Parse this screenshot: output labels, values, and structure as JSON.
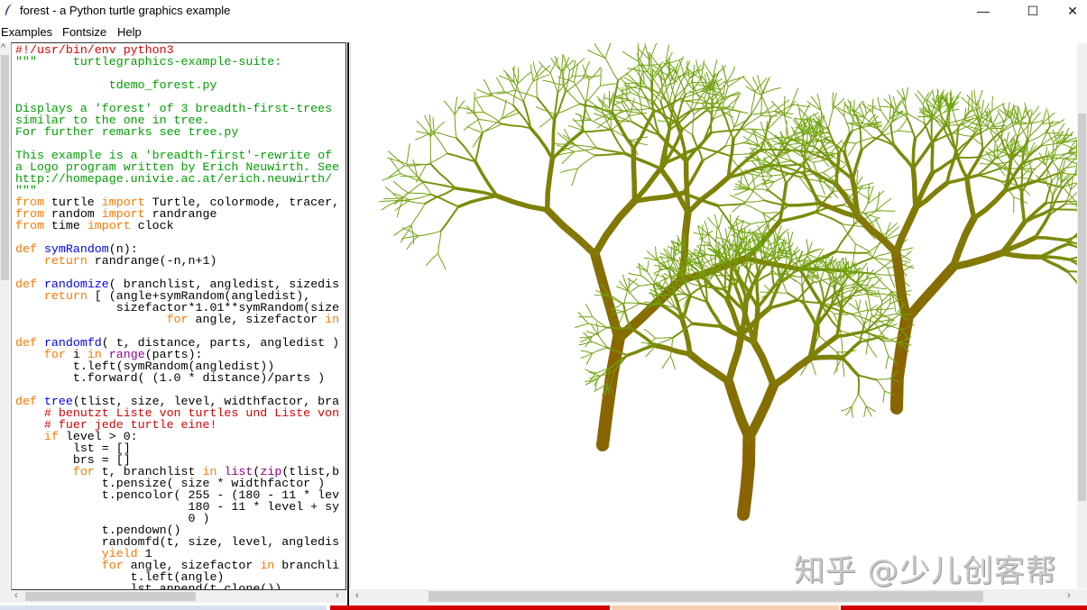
{
  "window": {
    "title": "forest - a Python turtle graphics example",
    "minimize": "—",
    "maximize": "☐",
    "close": "✕"
  },
  "menu": [
    "Examples",
    "Fontsize",
    "Help"
  ],
  "code": [
    [
      [
        "com",
        "#!/usr/bin/env python3"
      ]
    ],
    [
      [
        "str",
        "\"\"\"     turtlegraphics-example-suite:"
      ]
    ],
    [],
    [
      [
        "str",
        "             tdemo_forest.py"
      ]
    ],
    [],
    [
      [
        "str",
        "Displays a 'forest' of 3 breadth-first-trees"
      ]
    ],
    [
      [
        "str",
        "similar to the one in tree."
      ]
    ],
    [
      [
        "str",
        "For further remarks see tree.py"
      ]
    ],
    [],
    [
      [
        "str",
        "This example is a 'breadth-first'-rewrite of"
      ]
    ],
    [
      [
        "str",
        "a Logo program written by Erich Neuwirth. See"
      ]
    ],
    [
      [
        "str",
        "http://homepage.univie.ac.at/erich.neuwirth/"
      ]
    ],
    [
      [
        "str",
        "\"\"\""
      ]
    ],
    [
      [
        "kw",
        "from"
      ],
      [
        "",
        " turtle "
      ],
      [
        "kw",
        "import"
      ],
      [
        "",
        " Turtle, colormode, tracer,"
      ]
    ],
    [
      [
        "kw",
        "from"
      ],
      [
        "",
        " random "
      ],
      [
        "kw",
        "import"
      ],
      [
        "",
        " randrange"
      ]
    ],
    [
      [
        "kw",
        "from"
      ],
      [
        "",
        " time "
      ],
      [
        "kw",
        "import"
      ],
      [
        "",
        " clock"
      ]
    ],
    [],
    [
      [
        "kw",
        "def"
      ],
      [
        "",
        " "
      ],
      [
        "def",
        "symRandom"
      ],
      [
        "",
        "(n):"
      ]
    ],
    [
      [
        "",
        "    "
      ],
      [
        "kw",
        "return"
      ],
      [
        "",
        " randrange(-n,n+1)"
      ]
    ],
    [],
    [
      [
        "kw",
        "def"
      ],
      [
        "",
        " "
      ],
      [
        "def",
        "randomize"
      ],
      [
        "",
        "( branchlist, angledist, sizedis"
      ]
    ],
    [
      [
        "",
        "    "
      ],
      [
        "kw",
        "return"
      ],
      [
        "",
        " [ (angle+symRandom(angledist),"
      ]
    ],
    [
      [
        "",
        "              sizefactor*1.01**symRandom(size"
      ]
    ],
    [
      [
        "",
        "                     "
      ],
      [
        "kw",
        "for"
      ],
      [
        "",
        " angle, sizefactor "
      ],
      [
        "kw",
        "in"
      ]
    ],
    [],
    [
      [
        "kw",
        "def"
      ],
      [
        "",
        " "
      ],
      [
        "def",
        "randomfd"
      ],
      [
        "",
        "( t, distance, parts, angledist )"
      ]
    ],
    [
      [
        "",
        "    "
      ],
      [
        "kw",
        "for"
      ],
      [
        "",
        " i "
      ],
      [
        "kw",
        "in"
      ],
      [
        "",
        " "
      ],
      [
        "bi",
        "range"
      ],
      [
        "",
        "(parts):"
      ]
    ],
    [
      [
        "",
        "        t.left(symRandom(angledist))"
      ]
    ],
    [
      [
        "",
        "        t.forward( (1.0 * distance)/parts )"
      ]
    ],
    [],
    [
      [
        "kw",
        "def"
      ],
      [
        "",
        " "
      ],
      [
        "def",
        "tree"
      ],
      [
        "",
        "(tlist, size, level, widthfactor, bra"
      ]
    ],
    [
      [
        "",
        "    "
      ],
      [
        "com",
        "# benutzt Liste von turtles und Liste von"
      ]
    ],
    [
      [
        "",
        "    "
      ],
      [
        "com",
        "# fuer jede turtle eine!"
      ]
    ],
    [
      [
        "",
        "    "
      ],
      [
        "kw",
        "if"
      ],
      [
        "",
        " level > 0:"
      ]
    ],
    [
      [
        "",
        "        lst = []"
      ]
    ],
    [
      [
        "",
        "        brs = []"
      ]
    ],
    [
      [
        "",
        "        "
      ],
      [
        "kw",
        "for"
      ],
      [
        "",
        " t, branchlist "
      ],
      [
        "kw",
        "in"
      ],
      [
        "",
        " "
      ],
      [
        "bi",
        "list"
      ],
      [
        "",
        "("
      ],
      [
        "bi",
        "zip"
      ],
      [
        "",
        "(tlist,b"
      ]
    ],
    [
      [
        "",
        "            t.pensize( size * widthfactor )"
      ]
    ],
    [
      [
        "",
        "            t.pencolor( 255 - (180 - 11 * lev"
      ]
    ],
    [
      [
        "",
        "                        180 - 11 * level + sy"
      ]
    ],
    [
      [
        "",
        "                        0 )"
      ]
    ],
    [
      [
        "",
        "            t.pendown()"
      ]
    ],
    [
      [
        "",
        "            randomfd(t, size, level, angledis"
      ]
    ],
    [
      [
        "",
        "            "
      ],
      [
        "kw",
        "yield"
      ],
      [
        "",
        " 1"
      ]
    ],
    [
      [
        "",
        "            "
      ],
      [
        "kw",
        "for"
      ],
      [
        "",
        " angle, sizefactor "
      ],
      [
        "kw",
        "in"
      ],
      [
        "",
        " branchli"
      ]
    ],
    [
      [
        "",
        "                t.left(angle)"
      ]
    ],
    [
      [
        "",
        "                lst.append(t.clone())"
      ]
    ]
  ],
  "watermark": "知乎 @少儿创客帮",
  "colors": {
    "trunk": "#8a6400",
    "leaf": "#6cae12",
    "button_red": "#d40000",
    "button_peach": "#f7cfb0"
  }
}
